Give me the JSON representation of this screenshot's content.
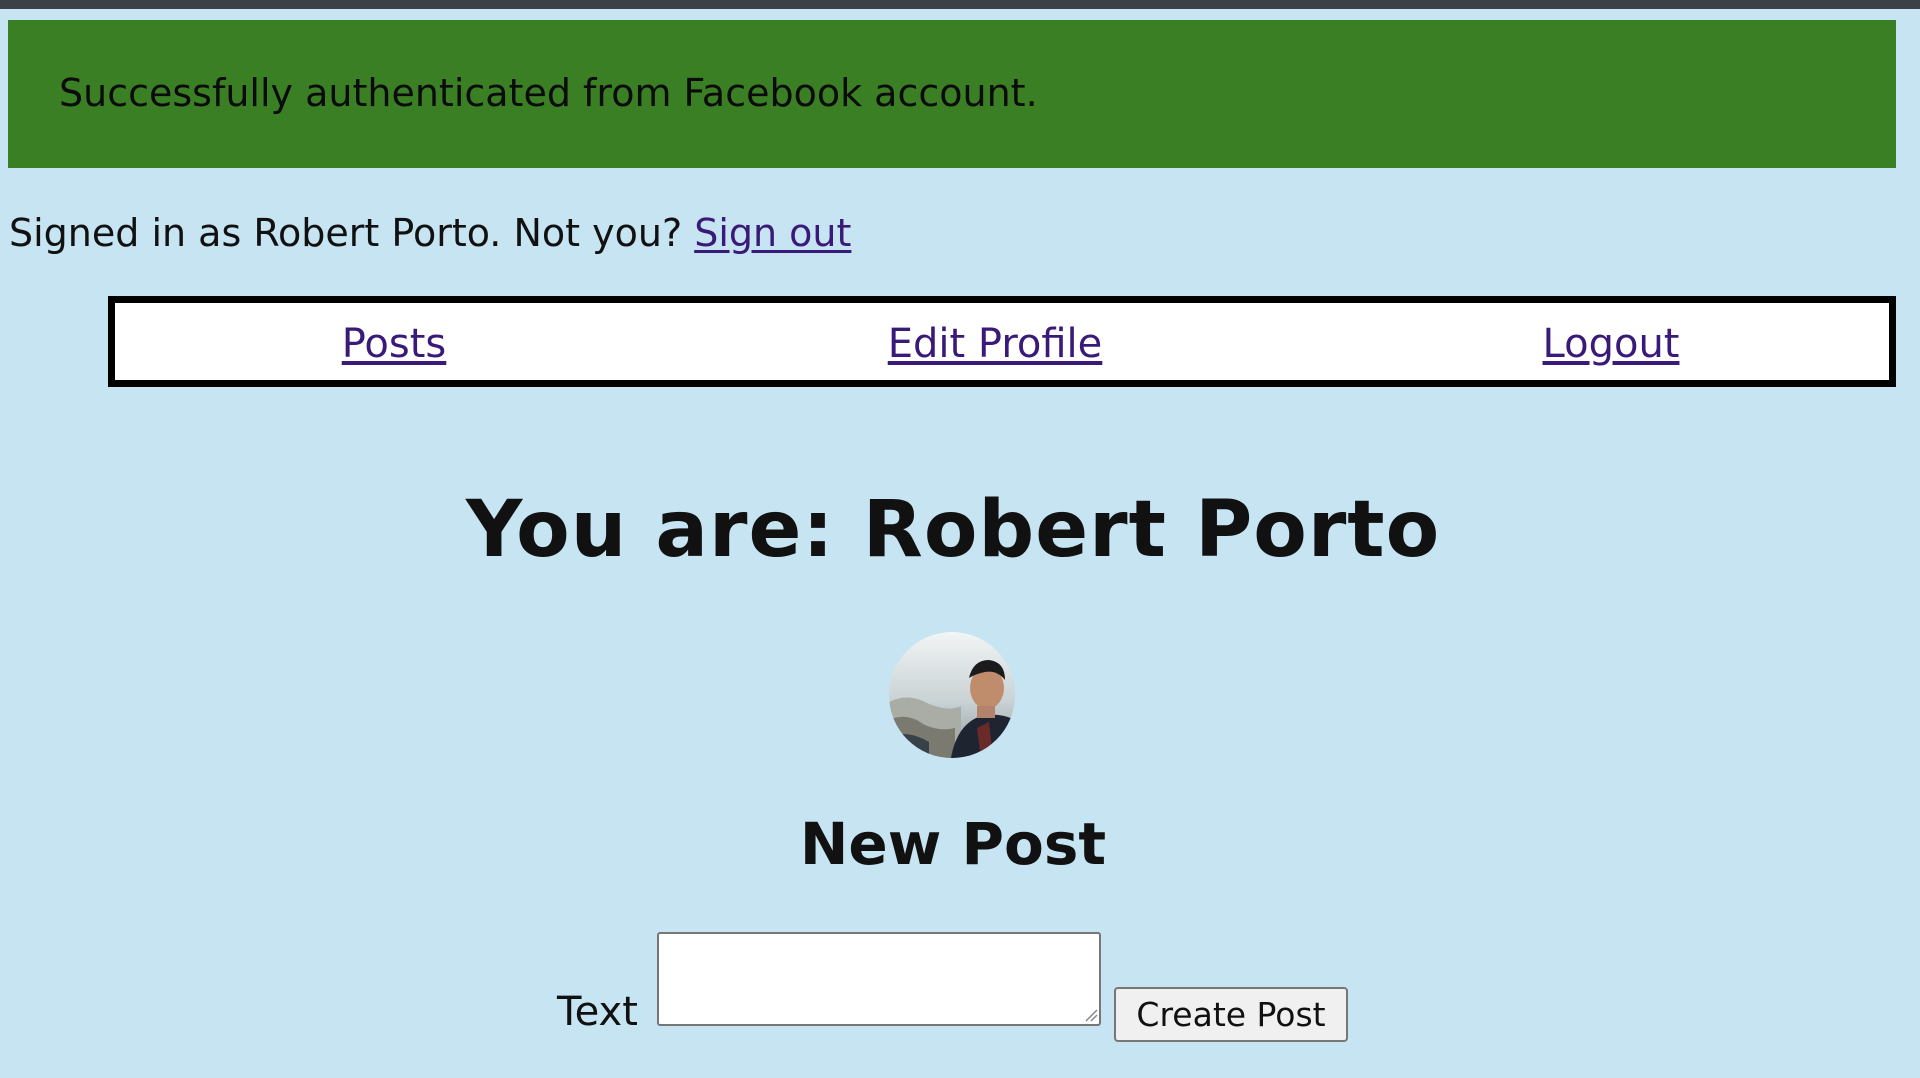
{
  "flash": {
    "message": "Successfully authenticated from Facebook account."
  },
  "session": {
    "signed_in_text": "Signed in as Robert Porto. Not you?",
    "sign_out_label": "Sign out"
  },
  "nav": {
    "items": [
      {
        "label": "Posts"
      },
      {
        "label": "Edit Profile"
      },
      {
        "label": "Logout"
      }
    ]
  },
  "profile": {
    "heading": "You are: Robert Porto",
    "avatar_icon": "user-avatar-photo"
  },
  "new_post": {
    "heading": "New Post",
    "text_label": "Text",
    "text_value": "",
    "submit_label": "Create Post"
  },
  "colors": {
    "background": "#c7e4f3",
    "flash_success": "#3a7f23",
    "link": "#3a1a78"
  }
}
